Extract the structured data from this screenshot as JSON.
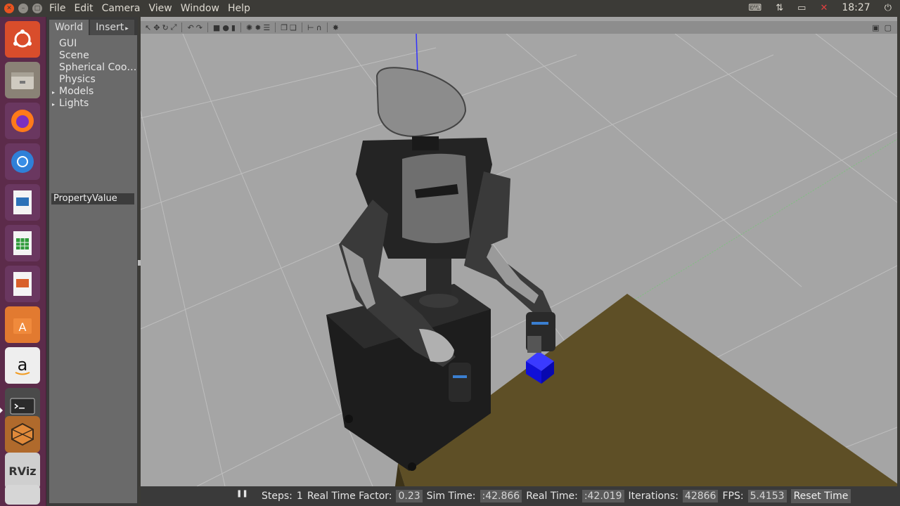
{
  "menubar": {
    "items": [
      "File",
      "Edit",
      "Camera",
      "View",
      "Window",
      "Help"
    ],
    "clock": "18:27"
  },
  "launcher": {
    "apps": [
      "ubuntu-dash",
      "files",
      "firefox",
      "chromium",
      "libreoffice-draw",
      "libreoffice-calc",
      "libreoffice-impress",
      "ubuntu-software",
      "amazon",
      "terminal",
      "gazebo",
      "rviz",
      "text-editor"
    ]
  },
  "left_panel": {
    "tabs": [
      "World",
      "Insert"
    ],
    "tree": [
      "GUI",
      "Scene",
      "Spherical Coo…",
      "Physics",
      "Models",
      "Lights"
    ],
    "prop_header": "PropertyValue"
  },
  "status": {
    "steps_label": "Steps:",
    "steps_value": "1",
    "rtf_label": "Real Time Factor:",
    "rtf_value": "0.23",
    "sim_label": "Sim Time:",
    "sim_value": ":42.866",
    "real_label": "Real Time:",
    "real_value": ":42.019",
    "iter_label": "Iterations:",
    "iter_value": "42866",
    "fps_label": "FPS:",
    "fps_value": "5.4153",
    "reset_label": "Reset Time"
  },
  "colors": {
    "ubuntu_orange": "#e95420",
    "launcher_bg": "#5c2b4a",
    "viewport_bg": "#a3a3a3",
    "table": "#5e4f26",
    "cube": "#1010e0"
  }
}
